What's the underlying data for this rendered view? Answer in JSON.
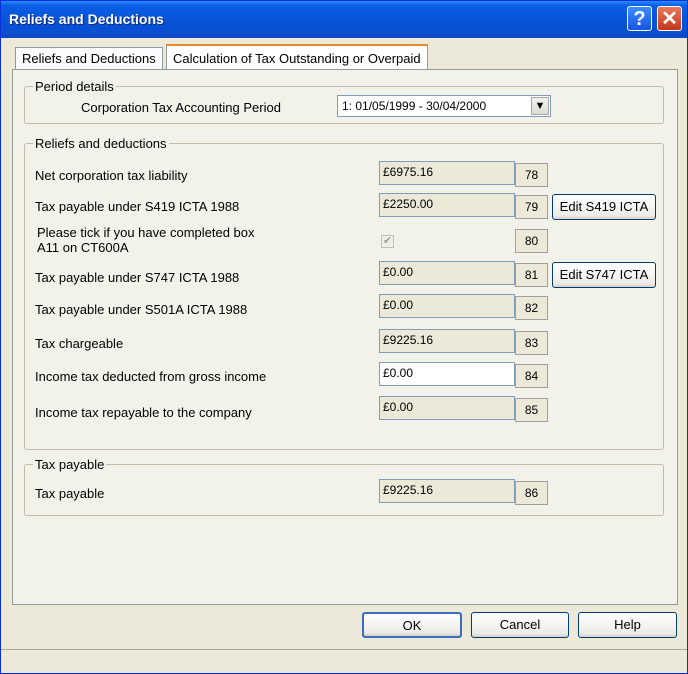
{
  "window": {
    "title": "Reliefs and Deductions",
    "help_glyph": "?",
    "close_glyph": "✕"
  },
  "tabs": [
    {
      "label": "Reliefs and Deductions"
    },
    {
      "label": "Calculation of Tax Outstanding or Overpaid"
    }
  ],
  "period": {
    "group_title": "Period details",
    "label": "Corporation Tax Accounting Period",
    "selected": "1: 01/05/1999 - 30/04/2000",
    "arrow_glyph": "▼"
  },
  "reliefs": {
    "group_title": "Reliefs and deductions",
    "rows": [
      {
        "label": "Net corporation tax liability",
        "value": "£6975.16",
        "box": "78"
      },
      {
        "label": "Tax payable under S419 ICTA 1988",
        "value": "£2250.00",
        "box": "79",
        "button": "Edit S419 ICTA"
      },
      {
        "label_line1": "Please tick if you have completed box",
        "label_line2": "A11 on CT600A",
        "checked": true,
        "check_glyph": "✔",
        "box": "80"
      },
      {
        "label": "Tax payable under S747 ICTA 1988",
        "value": "£0.00",
        "box": "81",
        "button": "Edit S747 ICTA"
      },
      {
        "label": "Tax payable under S501A ICTA 1988",
        "value": "£0.00",
        "box": "82"
      },
      {
        "label": "Tax chargeable",
        "value": "£9225.16",
        "box": "83"
      },
      {
        "label": "Income tax deducted from gross income",
        "value": "£0.00",
        "box": "84"
      },
      {
        "label": "Income tax repayable to the company",
        "value": "£0.00",
        "box": "85"
      }
    ]
  },
  "tax_payable": {
    "group_title": "Tax payable",
    "label": "Tax payable",
    "value": "£9225.16",
    "box": "86"
  },
  "footer": {
    "ok": "OK",
    "cancel": "Cancel",
    "help": "Help"
  }
}
